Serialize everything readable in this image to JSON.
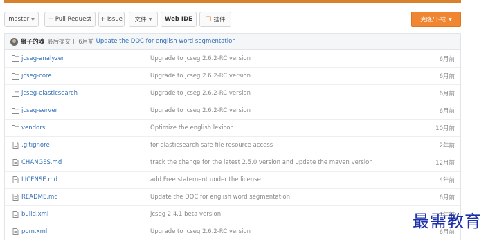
{
  "toolbar": {
    "branch": "master",
    "pull_request": "+ Pull Request",
    "issue": "+ Issue",
    "file_menu": "文件",
    "web_ide": "Web IDE",
    "star": "挂件",
    "download": "克隆/下载"
  },
  "commit": {
    "author": "狮子的魂",
    "meta": "最后提交于 6月前",
    "message": "Update the DOC for english word segmentation"
  },
  "files": [
    {
      "type": "folder",
      "name": "jcseg-analyzer",
      "message": "Upgrade to jcseg 2.6.2-RC version",
      "time": "6月前"
    },
    {
      "type": "folder",
      "name": "jcseg-core",
      "message": "Upgrade to jcseg 2.6.2-RC version",
      "time": "6月前"
    },
    {
      "type": "folder",
      "name": "jcseg-elasticsearch",
      "message": "Upgrade to jcseg 2.6.2-RC version",
      "time": "6月前"
    },
    {
      "type": "folder",
      "name": "jcseg-server",
      "message": "Upgrade to jcseg 2.6.2-RC version",
      "time": "6月前"
    },
    {
      "type": "folder",
      "name": "vendors",
      "message": "Optimize the english lexicon",
      "time": "10月前"
    },
    {
      "type": "file",
      "name": ".gitignore",
      "message": "for elasticsearch safe file resource access",
      "time": "2年前"
    },
    {
      "type": "file",
      "name": "CHANGES.md",
      "message": "track the change for the latest 2.5.0 version and update the maven version",
      "time": "12月前"
    },
    {
      "type": "file",
      "name": "LICENSE.md",
      "message": "add Free statement under the license",
      "time": "4年前"
    },
    {
      "type": "file",
      "name": "README.md",
      "message": "Update the DOC for english word segmentation",
      "time": "6月前"
    },
    {
      "type": "file",
      "name": "build.xml",
      "message": "jcseg 2.4.1 beta version",
      "time": "1年前"
    },
    {
      "type": "file",
      "name": "pom.xml",
      "message": "Upgrade to jcseg 2.6.2-RC version",
      "time": "6月前"
    }
  ],
  "watermark": "最需教育",
  "colors": {
    "accent": "#f08632",
    "link": "#2f6eb5",
    "topbar": "#d9822b"
  }
}
